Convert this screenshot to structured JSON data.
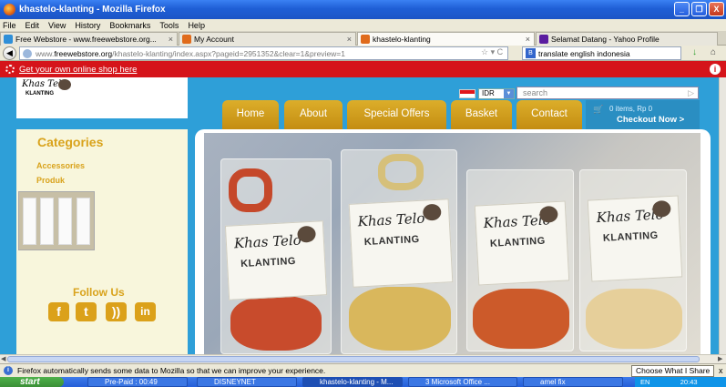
{
  "window": {
    "title": "khastelo-klanting - Mozilla Firefox",
    "buttons": [
      "_",
      "❐",
      "X"
    ]
  },
  "menu": [
    "File",
    "Edit",
    "View",
    "History",
    "Bookmarks",
    "Tools",
    "Help"
  ],
  "tabs": [
    {
      "label": "Free Webstore - www.freewebstore.org...",
      "color": "#2f8fd8"
    },
    {
      "label": "My Account",
      "color": "#e06b1c"
    },
    {
      "label": "khastelo-klanting",
      "color": "#e06b1c",
      "active": true
    },
    {
      "label": "Selamat Datang - Yahoo Profile",
      "color": "#5a1ca0"
    }
  ],
  "address": {
    "prefix": "www.",
    "domain": "freewebstore.org",
    "path": "/khastelo-klanting/index.aspx?pageid=2951352&clear=1&preview=1"
  },
  "browser_search": {
    "value": "translate english indonesia"
  },
  "promo": {
    "text": "Get your own online shop here",
    "info": "i"
  },
  "store": {
    "logo_script": "Khas Telo",
    "logo_name": "KLANTING",
    "currency": "IDR",
    "search_placeholder": "search",
    "nav": [
      "Home",
      "About",
      "Special Offers",
      "Basket",
      "Contact"
    ],
    "cart": {
      "items": "0 items, Rp 0",
      "checkout": "Checkout Now >"
    },
    "categories_title": "Categories",
    "categories": [
      "Accessories",
      "Produk"
    ],
    "follow_title": "Follow Us",
    "social": [
      "f",
      "t",
      "rss",
      "in"
    ],
    "accent": "#d9a31c"
  },
  "product_labels": [
    {
      "script": "Khas Telo",
      "name": "KLANTING"
    },
    {
      "script": "Khas Telo",
      "name": "KLANTING"
    },
    {
      "script": "Khas Telo",
      "name": "KLANTING"
    },
    {
      "script": "Khas Telo",
      "name": "KLANTING"
    }
  ],
  "notification": {
    "text": "Firefox automatically sends some data to Mozilla so that we can improve your experience.",
    "button": "Choose What I Share",
    "close": "x"
  },
  "taskbar": {
    "start": "start",
    "tasks": [
      "Pre-Paid : 00:49",
      "DISNEYNET",
      "khastelo-klanting - M...",
      "3 Microsoft Office ...",
      "amel fix"
    ],
    "tray": "EN",
    "clock": "20:43"
  }
}
